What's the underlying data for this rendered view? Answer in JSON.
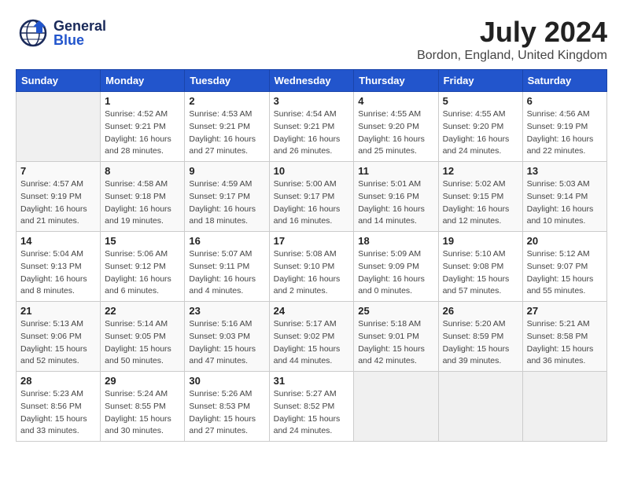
{
  "header": {
    "logo_general": "General",
    "logo_blue": "Blue",
    "month_year": "July 2024",
    "location": "Bordon, England, United Kingdom"
  },
  "weekdays": [
    "Sunday",
    "Monday",
    "Tuesday",
    "Wednesday",
    "Thursday",
    "Friday",
    "Saturday"
  ],
  "weeks": [
    [
      {
        "day": "",
        "sunrise": "",
        "sunset": "",
        "daylight": ""
      },
      {
        "day": "1",
        "sunrise": "Sunrise: 4:52 AM",
        "sunset": "Sunset: 9:21 PM",
        "daylight": "Daylight: 16 hours and 28 minutes."
      },
      {
        "day": "2",
        "sunrise": "Sunrise: 4:53 AM",
        "sunset": "Sunset: 9:21 PM",
        "daylight": "Daylight: 16 hours and 27 minutes."
      },
      {
        "day": "3",
        "sunrise": "Sunrise: 4:54 AM",
        "sunset": "Sunset: 9:21 PM",
        "daylight": "Daylight: 16 hours and 26 minutes."
      },
      {
        "day": "4",
        "sunrise": "Sunrise: 4:55 AM",
        "sunset": "Sunset: 9:20 PM",
        "daylight": "Daylight: 16 hours and 25 minutes."
      },
      {
        "day": "5",
        "sunrise": "Sunrise: 4:55 AM",
        "sunset": "Sunset: 9:20 PM",
        "daylight": "Daylight: 16 hours and 24 minutes."
      },
      {
        "day": "6",
        "sunrise": "Sunrise: 4:56 AM",
        "sunset": "Sunset: 9:19 PM",
        "daylight": "Daylight: 16 hours and 22 minutes."
      }
    ],
    [
      {
        "day": "7",
        "sunrise": "Sunrise: 4:57 AM",
        "sunset": "Sunset: 9:19 PM",
        "daylight": "Daylight: 16 hours and 21 minutes."
      },
      {
        "day": "8",
        "sunrise": "Sunrise: 4:58 AM",
        "sunset": "Sunset: 9:18 PM",
        "daylight": "Daylight: 16 hours and 19 minutes."
      },
      {
        "day": "9",
        "sunrise": "Sunrise: 4:59 AM",
        "sunset": "Sunset: 9:17 PM",
        "daylight": "Daylight: 16 hours and 18 minutes."
      },
      {
        "day": "10",
        "sunrise": "Sunrise: 5:00 AM",
        "sunset": "Sunset: 9:17 PM",
        "daylight": "Daylight: 16 hours and 16 minutes."
      },
      {
        "day": "11",
        "sunrise": "Sunrise: 5:01 AM",
        "sunset": "Sunset: 9:16 PM",
        "daylight": "Daylight: 16 hours and 14 minutes."
      },
      {
        "day": "12",
        "sunrise": "Sunrise: 5:02 AM",
        "sunset": "Sunset: 9:15 PM",
        "daylight": "Daylight: 16 hours and 12 minutes."
      },
      {
        "day": "13",
        "sunrise": "Sunrise: 5:03 AM",
        "sunset": "Sunset: 9:14 PM",
        "daylight": "Daylight: 16 hours and 10 minutes."
      }
    ],
    [
      {
        "day": "14",
        "sunrise": "Sunrise: 5:04 AM",
        "sunset": "Sunset: 9:13 PM",
        "daylight": "Daylight: 16 hours and 8 minutes."
      },
      {
        "day": "15",
        "sunrise": "Sunrise: 5:06 AM",
        "sunset": "Sunset: 9:12 PM",
        "daylight": "Daylight: 16 hours and 6 minutes."
      },
      {
        "day": "16",
        "sunrise": "Sunrise: 5:07 AM",
        "sunset": "Sunset: 9:11 PM",
        "daylight": "Daylight: 16 hours and 4 minutes."
      },
      {
        "day": "17",
        "sunrise": "Sunrise: 5:08 AM",
        "sunset": "Sunset: 9:10 PM",
        "daylight": "Daylight: 16 hours and 2 minutes."
      },
      {
        "day": "18",
        "sunrise": "Sunrise: 5:09 AM",
        "sunset": "Sunset: 9:09 PM",
        "daylight": "Daylight: 16 hours and 0 minutes."
      },
      {
        "day": "19",
        "sunrise": "Sunrise: 5:10 AM",
        "sunset": "Sunset: 9:08 PM",
        "daylight": "Daylight: 15 hours and 57 minutes."
      },
      {
        "day": "20",
        "sunrise": "Sunrise: 5:12 AM",
        "sunset": "Sunset: 9:07 PM",
        "daylight": "Daylight: 15 hours and 55 minutes."
      }
    ],
    [
      {
        "day": "21",
        "sunrise": "Sunrise: 5:13 AM",
        "sunset": "Sunset: 9:06 PM",
        "daylight": "Daylight: 15 hours and 52 minutes."
      },
      {
        "day": "22",
        "sunrise": "Sunrise: 5:14 AM",
        "sunset": "Sunset: 9:05 PM",
        "daylight": "Daylight: 15 hours and 50 minutes."
      },
      {
        "day": "23",
        "sunrise": "Sunrise: 5:16 AM",
        "sunset": "Sunset: 9:03 PM",
        "daylight": "Daylight: 15 hours and 47 minutes."
      },
      {
        "day": "24",
        "sunrise": "Sunrise: 5:17 AM",
        "sunset": "Sunset: 9:02 PM",
        "daylight": "Daylight: 15 hours and 44 minutes."
      },
      {
        "day": "25",
        "sunrise": "Sunrise: 5:18 AM",
        "sunset": "Sunset: 9:01 PM",
        "daylight": "Daylight: 15 hours and 42 minutes."
      },
      {
        "day": "26",
        "sunrise": "Sunrise: 5:20 AM",
        "sunset": "Sunset: 8:59 PM",
        "daylight": "Daylight: 15 hours and 39 minutes."
      },
      {
        "day": "27",
        "sunrise": "Sunrise: 5:21 AM",
        "sunset": "Sunset: 8:58 PM",
        "daylight": "Daylight: 15 hours and 36 minutes."
      }
    ],
    [
      {
        "day": "28",
        "sunrise": "Sunrise: 5:23 AM",
        "sunset": "Sunset: 8:56 PM",
        "daylight": "Daylight: 15 hours and 33 minutes."
      },
      {
        "day": "29",
        "sunrise": "Sunrise: 5:24 AM",
        "sunset": "Sunset: 8:55 PM",
        "daylight": "Daylight: 15 hours and 30 minutes."
      },
      {
        "day": "30",
        "sunrise": "Sunrise: 5:26 AM",
        "sunset": "Sunset: 8:53 PM",
        "daylight": "Daylight: 15 hours and 27 minutes."
      },
      {
        "day": "31",
        "sunrise": "Sunrise: 5:27 AM",
        "sunset": "Sunset: 8:52 PM",
        "daylight": "Daylight: 15 hours and 24 minutes."
      },
      {
        "day": "",
        "sunrise": "",
        "sunset": "",
        "daylight": ""
      },
      {
        "day": "",
        "sunrise": "",
        "sunset": "",
        "daylight": ""
      },
      {
        "day": "",
        "sunrise": "",
        "sunset": "",
        "daylight": ""
      }
    ]
  ]
}
